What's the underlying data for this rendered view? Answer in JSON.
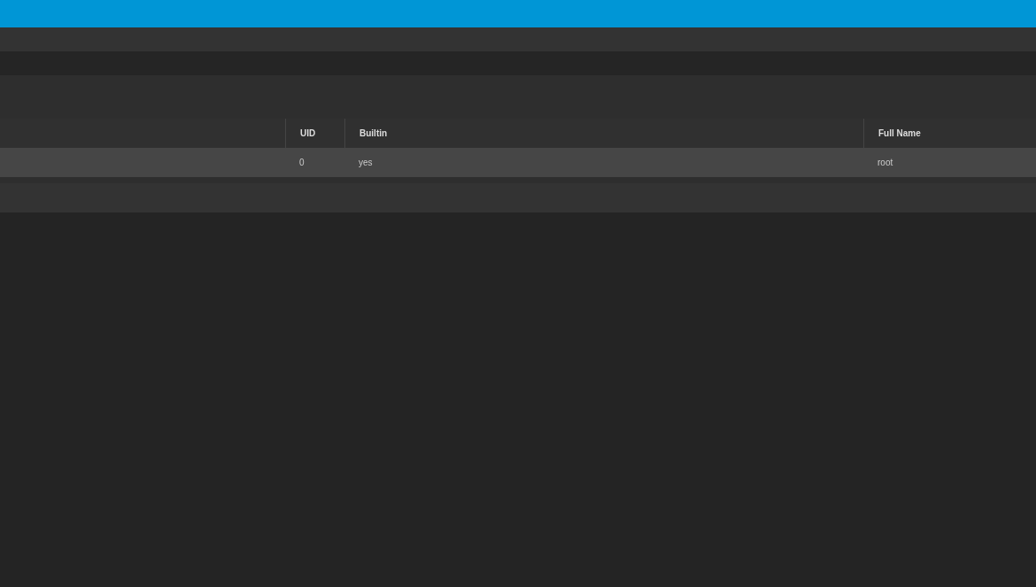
{
  "table": {
    "columns": [
      "UID",
      "Builtin",
      "Full Name"
    ],
    "rows": [
      {
        "cells": [
          "0",
          "yes",
          "root"
        ],
        "selected": true
      }
    ]
  }
}
